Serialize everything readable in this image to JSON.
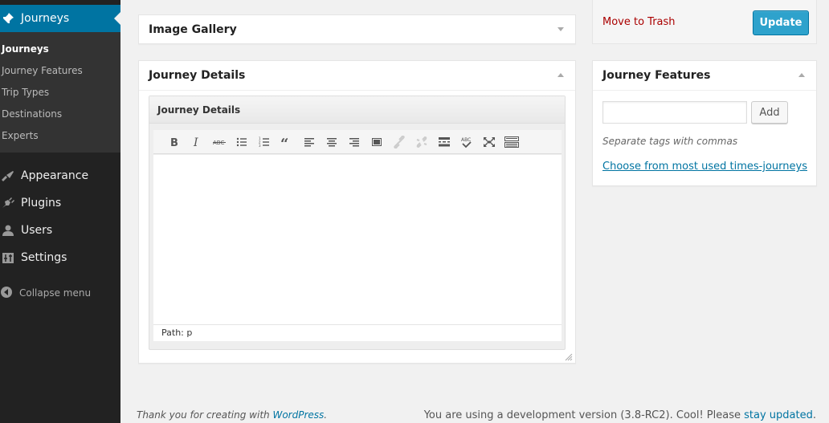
{
  "sidebar": {
    "current_menu": {
      "label": "Journeys",
      "icon": "pushpin-icon"
    },
    "submenu": [
      {
        "label": "Journeys",
        "current": true
      },
      {
        "label": "Journey Features"
      },
      {
        "label": "Trip Types"
      },
      {
        "label": "Destinations"
      },
      {
        "label": "Experts"
      }
    ],
    "items": [
      {
        "label": "Appearance",
        "icon": "paintbrush-icon"
      },
      {
        "label": "Plugins",
        "icon": "plug-icon"
      },
      {
        "label": "Users",
        "icon": "user-icon"
      },
      {
        "label": "Settings",
        "icon": "settings-sliders-icon"
      }
    ],
    "collapse_label": "Collapse menu"
  },
  "main": {
    "image_gallery": {
      "title": "Image Gallery"
    },
    "journey_details": {
      "title": "Journey Details",
      "editor_title": "Journey Details",
      "toolbar": [
        "bold",
        "italic",
        "strikethrough",
        "bullet-list",
        "numbered-list",
        "blockquote",
        "align-left",
        "align-center",
        "align-right",
        "insert-more",
        "link",
        "unlink",
        "read-more",
        "spellcheck",
        "fullscreen",
        "kitchen-sink"
      ],
      "content": "",
      "path_label": "Path: p"
    }
  },
  "publish": {
    "trash_label": "Move to Trash",
    "update_label": "Update"
  },
  "journey_features": {
    "title": "Journey Features",
    "input_value": "",
    "add_label": "Add",
    "howto": "Separate tags with commas",
    "choose_link": "Choose from most used times-journeys"
  },
  "footer": {
    "thanks_prefix": "Thank you for creating with ",
    "thanks_link": "WordPress",
    "thanks_suffix": ".",
    "version_prefix": "You are using a development version (3.8-RC2). Cool! Please ",
    "version_link": "stay updated",
    "version_suffix": "."
  },
  "colors": {
    "sidebar_bg": "#222222",
    "submenu_bg": "#333333",
    "accent": "#0074a2",
    "button_primary": "#2ea2cc",
    "trash": "#aa0000",
    "page_bg": "#f1f1f1"
  }
}
